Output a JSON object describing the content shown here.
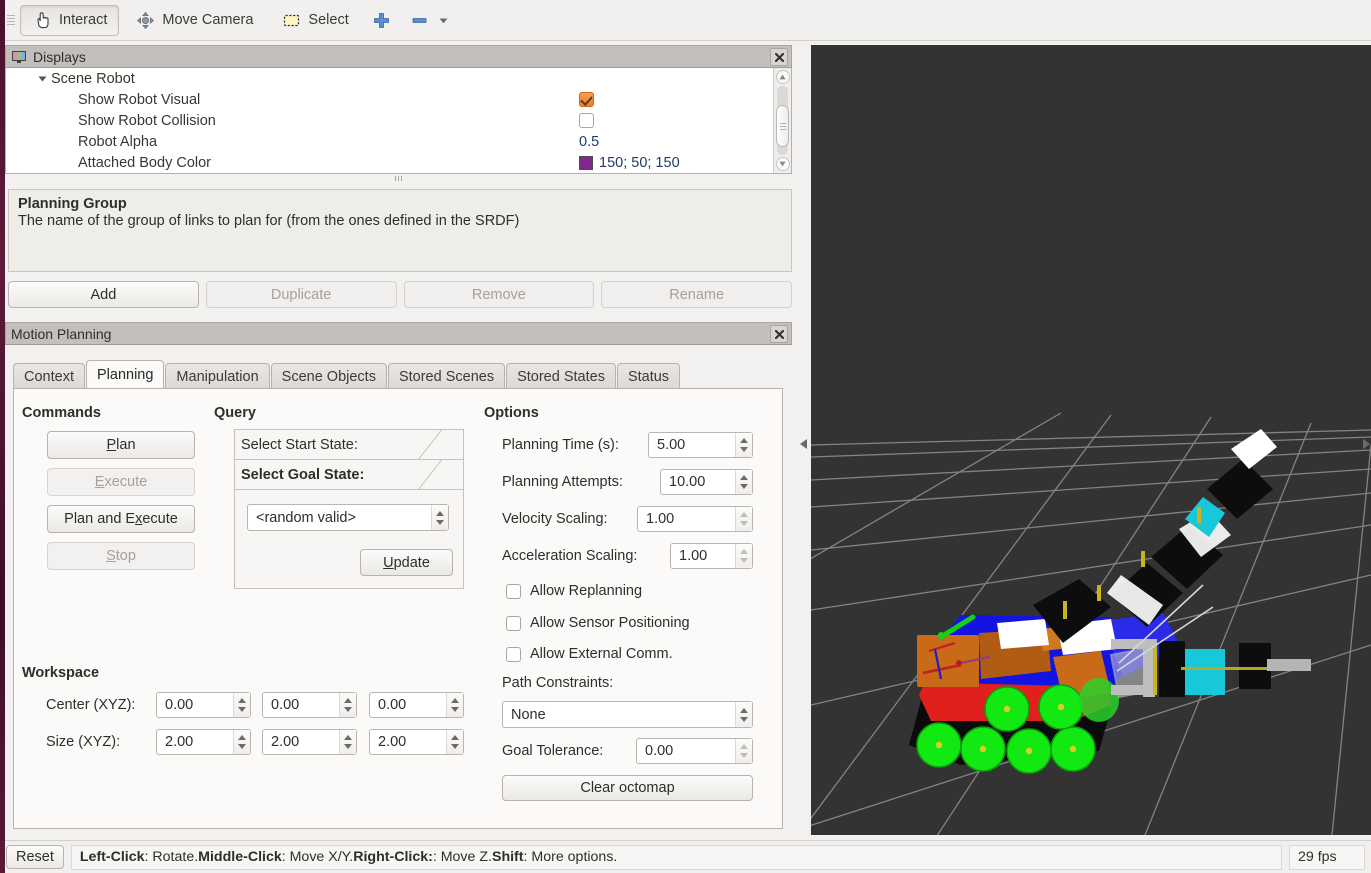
{
  "toolbar": {
    "items": [
      {
        "label": "Interact",
        "icon": "hand-cursor-icon",
        "pressed": true
      },
      {
        "label": "Move Camera",
        "icon": "move-camera-icon",
        "pressed": false
      },
      {
        "label": "Select",
        "icon": "select-rect-icon",
        "pressed": false
      },
      {
        "label": "",
        "icon": "plus-icon",
        "pressed": false
      },
      {
        "label": "",
        "icon": "minus-icon",
        "pressed": false
      }
    ]
  },
  "displays": {
    "title": "Displays",
    "close_label": "✖",
    "rows": [
      {
        "name": "Scene Robot",
        "value": "",
        "kind": "group",
        "indent": 1
      },
      {
        "name": "Show Robot Visual",
        "value": "",
        "kind": "checkbox-on",
        "indent": 2
      },
      {
        "name": "Show Robot Collision",
        "value": "",
        "kind": "checkbox-off",
        "indent": 2
      },
      {
        "name": "Robot Alpha",
        "value": "0.5",
        "kind": "text",
        "indent": 2
      },
      {
        "name": "Attached Body Color",
        "value": "150; 50; 150",
        "kind": "color",
        "color": "#7d2a8c",
        "indent": 2
      }
    ]
  },
  "help": {
    "title": "Planning Group",
    "body": "The name of the group of links to plan for (from the ones defined in the SRDF)"
  },
  "display_buttons": [
    {
      "label": "Add",
      "enabled": true
    },
    {
      "label": "Duplicate",
      "enabled": false
    },
    {
      "label": "Remove",
      "enabled": false
    },
    {
      "label": "Rename",
      "enabled": false
    }
  ],
  "motion_planning": {
    "title": "Motion Planning",
    "close_label": "✖",
    "tabs": [
      {
        "label": "Context",
        "active": false
      },
      {
        "label": "Planning",
        "active": true
      },
      {
        "label": "Manipulation",
        "active": false
      },
      {
        "label": "Scene Objects",
        "active": false
      },
      {
        "label": "Stored Scenes",
        "active": false
      },
      {
        "label": "Stored States",
        "active": false
      },
      {
        "label": "Status",
        "active": false
      }
    ],
    "commands": {
      "heading": "Commands",
      "buttons": [
        {
          "label": "Plan",
          "enabled": true
        },
        {
          "label": "Execute",
          "enabled": false
        },
        {
          "label": "Plan and Execute",
          "enabled": true
        },
        {
          "label": "Stop",
          "enabled": false
        }
      ]
    },
    "query": {
      "heading": "Query",
      "start_state_header": "Select Start State:",
      "goal_state_header": "Select Goal State:",
      "goal_state_value": "<random valid>",
      "update_label": "Update"
    },
    "options": {
      "heading": "Options",
      "planning_time_label": "Planning Time (s):",
      "planning_time_value": "5.00",
      "planning_attempts_label": "Planning Attempts:",
      "planning_attempts_value": "10.00",
      "velocity_scaling_label": "Velocity Scaling:",
      "velocity_scaling_value": "1.00",
      "acceleration_scaling_label": "Acceleration Scaling:",
      "acceleration_scaling_value": "1.00",
      "allow_replanning_label": "Allow Replanning",
      "allow_replanning_checked": false,
      "allow_sensor_positioning_label": "Allow Sensor Positioning",
      "allow_sensor_positioning_checked": false,
      "allow_external_comm_label": "Allow External Comm.",
      "allow_external_comm_checked": false,
      "path_constraints_label": "Path Constraints:",
      "path_constraints_value": "None",
      "goal_tolerance_label": "Goal Tolerance:",
      "goal_tolerance_value": "0.00",
      "clear_octomap_label": "Clear octomap"
    },
    "workspace": {
      "heading": "Workspace",
      "center_label": "Center (XYZ):",
      "center_values": [
        "0.00",
        "0.00",
        "0.00"
      ],
      "size_label": "Size (XYZ):",
      "size_values": [
        "2.00",
        "2.00",
        "2.00"
      ]
    }
  },
  "viewport": {
    "background_color": "#333333",
    "grid_color": "#9a9a9a"
  },
  "statusbar": {
    "reset_label": "Reset",
    "hint_parts": [
      {
        "text": "Left-Click",
        "bold": true
      },
      {
        "text": ": Rotate. ",
        "bold": false
      },
      {
        "text": "Middle-Click",
        "bold": true
      },
      {
        "text": ": Move X/Y. ",
        "bold": false
      },
      {
        "text": "Right-Click:",
        "bold": true
      },
      {
        "text": ": Move Z. ",
        "bold": false
      },
      {
        "text": "Shift",
        "bold": true
      },
      {
        "text": ": More options.",
        "bold": false
      }
    ],
    "fps": "29 fps"
  }
}
